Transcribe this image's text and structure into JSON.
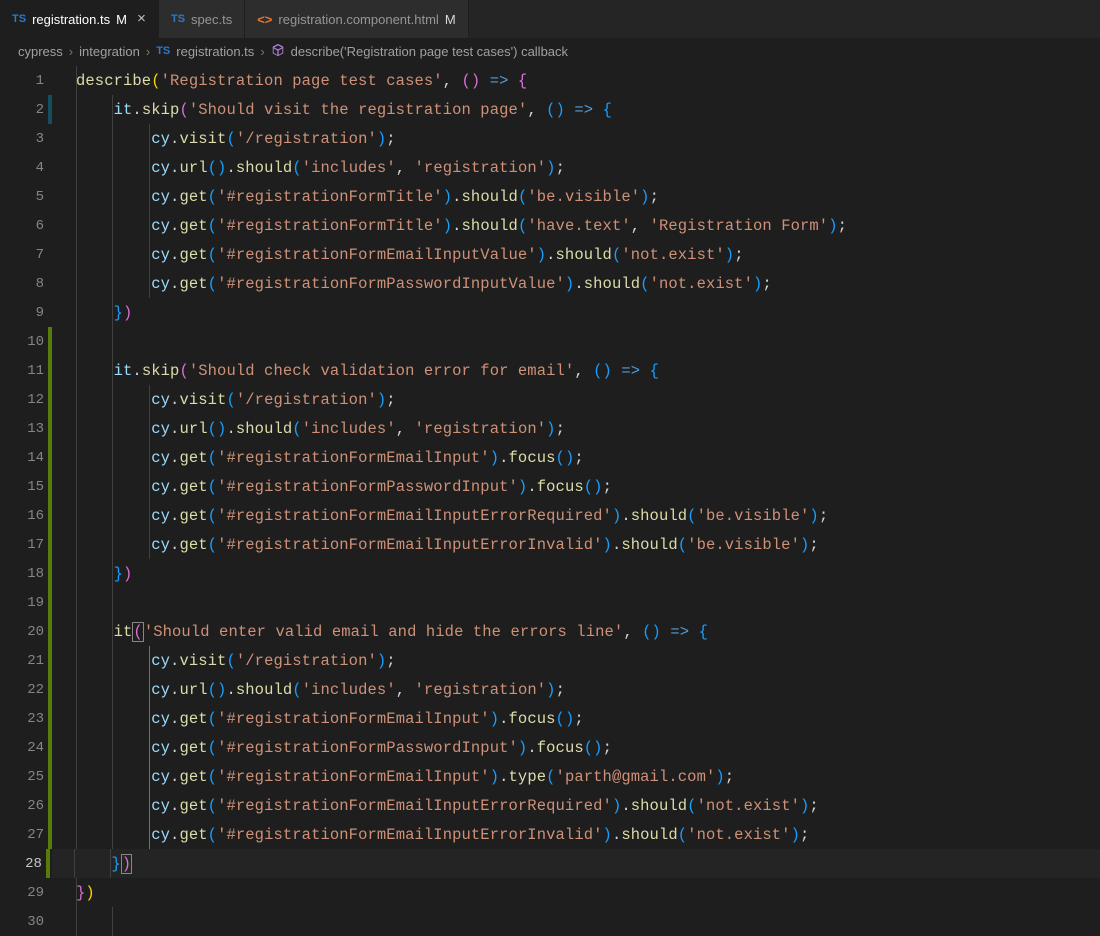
{
  "tabs": [
    {
      "icon": "TS",
      "name": "registration.ts",
      "modified": "M",
      "active": true,
      "close": true
    },
    {
      "icon": "TS",
      "name": "spec.ts",
      "modified": "",
      "active": false,
      "close": false
    },
    {
      "icon": "<>",
      "name": "registration.component.html",
      "modified": "M",
      "active": false,
      "close": false
    }
  ],
  "breadcrumb": {
    "p1": "cypress",
    "p2": "integration",
    "file_icon": "TS",
    "file": "registration.ts",
    "sym_icon": "cube",
    "symbol": "describe('Registration page test cases') callback"
  },
  "code": {
    "l1": {
      "n": "1",
      "git": "",
      "t": [
        [
          "fn",
          "describe"
        ],
        [
          "par",
          "("
        ],
        [
          "str",
          "'Registration page test cases'"
        ],
        [
          "pun",
          ", "
        ],
        [
          "par2",
          "()"
        ],
        [
          "pun",
          " "
        ],
        [
          "kw",
          "=>"
        ],
        [
          "pun",
          " "
        ],
        [
          "par2",
          "{"
        ]
      ]
    },
    "l2": {
      "n": "2",
      "git": "mod",
      "t": [
        [
          "pun",
          "    "
        ],
        [
          "var",
          "it"
        ],
        [
          "pun",
          "."
        ],
        [
          "fn",
          "skip"
        ],
        [
          "par2",
          "("
        ],
        [
          "str",
          "'Should visit the registration page'"
        ],
        [
          "pun",
          ", "
        ],
        [
          "par3",
          "()"
        ],
        [
          "pun",
          " "
        ],
        [
          "kw",
          "=>"
        ],
        [
          "pun",
          " "
        ],
        [
          "par3",
          "{"
        ]
      ]
    },
    "l3": {
      "n": "3",
      "git": "",
      "t": [
        [
          "pun",
          "        "
        ],
        [
          "var",
          "cy"
        ],
        [
          "pun",
          "."
        ],
        [
          "fn",
          "visit"
        ],
        [
          "par3",
          "("
        ],
        [
          "str",
          "'/registration'"
        ],
        [
          "par3",
          ")"
        ],
        [
          "pun",
          ";"
        ]
      ]
    },
    "l4": {
      "n": "4",
      "git": "",
      "t": [
        [
          "pun",
          "        "
        ],
        [
          "var",
          "cy"
        ],
        [
          "pun",
          "."
        ],
        [
          "fn",
          "url"
        ],
        [
          "par3",
          "()"
        ],
        [
          "pun",
          "."
        ],
        [
          "fn",
          "should"
        ],
        [
          "par3",
          "("
        ],
        [
          "str",
          "'includes'"
        ],
        [
          "pun",
          ", "
        ],
        [
          "str",
          "'registration'"
        ],
        [
          "par3",
          ")"
        ],
        [
          "pun",
          ";"
        ]
      ]
    },
    "l5": {
      "n": "5",
      "git": "",
      "t": [
        [
          "pun",
          "        "
        ],
        [
          "var",
          "cy"
        ],
        [
          "pun",
          "."
        ],
        [
          "fn",
          "get"
        ],
        [
          "par3",
          "("
        ],
        [
          "str",
          "'#registrationFormTitle'"
        ],
        [
          "par3",
          ")"
        ],
        [
          "pun",
          "."
        ],
        [
          "fn",
          "should"
        ],
        [
          "par3",
          "("
        ],
        [
          "str",
          "'be.visible'"
        ],
        [
          "par3",
          ")"
        ],
        [
          "pun",
          ";"
        ]
      ]
    },
    "l6": {
      "n": "6",
      "git": "",
      "t": [
        [
          "pun",
          "        "
        ],
        [
          "var",
          "cy"
        ],
        [
          "pun",
          "."
        ],
        [
          "fn",
          "get"
        ],
        [
          "par3",
          "("
        ],
        [
          "str",
          "'#registrationFormTitle'"
        ],
        [
          "par3",
          ")"
        ],
        [
          "pun",
          "."
        ],
        [
          "fn",
          "should"
        ],
        [
          "par3",
          "("
        ],
        [
          "str",
          "'have.text'"
        ],
        [
          "pun",
          ", "
        ],
        [
          "str",
          "'Registration Form'"
        ],
        [
          "par3",
          ")"
        ],
        [
          "pun",
          ";"
        ]
      ]
    },
    "l7": {
      "n": "7",
      "git": "",
      "t": [
        [
          "pun",
          "        "
        ],
        [
          "var",
          "cy"
        ],
        [
          "pun",
          "."
        ],
        [
          "fn",
          "get"
        ],
        [
          "par3",
          "("
        ],
        [
          "str",
          "'#registrationFormEmailInputValue'"
        ],
        [
          "par3",
          ")"
        ],
        [
          "pun",
          "."
        ],
        [
          "fn",
          "should"
        ],
        [
          "par3",
          "("
        ],
        [
          "str",
          "'not.exist'"
        ],
        [
          "par3",
          ")"
        ],
        [
          "pun",
          ";"
        ]
      ]
    },
    "l8": {
      "n": "8",
      "git": "",
      "t": [
        [
          "pun",
          "        "
        ],
        [
          "var",
          "cy"
        ],
        [
          "pun",
          "."
        ],
        [
          "fn",
          "get"
        ],
        [
          "par3",
          "("
        ],
        [
          "str",
          "'#registrationFormPasswordInputValue'"
        ],
        [
          "par3",
          ")"
        ],
        [
          "pun",
          "."
        ],
        [
          "fn",
          "should"
        ],
        [
          "par3",
          "("
        ],
        [
          "str",
          "'not.exist'"
        ],
        [
          "par3",
          ")"
        ],
        [
          "pun",
          ";"
        ]
      ]
    },
    "l9": {
      "n": "9",
      "git": "",
      "t": [
        [
          "pun",
          "    "
        ],
        [
          "par3",
          "}"
        ],
        [
          "par2",
          ")"
        ]
      ]
    },
    "l10": {
      "n": "10",
      "git": "add",
      "t": []
    },
    "l11": {
      "n": "11",
      "git": "add",
      "t": [
        [
          "pun",
          "    "
        ],
        [
          "var",
          "it"
        ],
        [
          "pun",
          "."
        ],
        [
          "fn",
          "skip"
        ],
        [
          "par2",
          "("
        ],
        [
          "str",
          "'Should check validation error for email'"
        ],
        [
          "pun",
          ", "
        ],
        [
          "par3",
          "()"
        ],
        [
          "pun",
          " "
        ],
        [
          "kw",
          "=>"
        ],
        [
          "pun",
          " "
        ],
        [
          "par3",
          "{"
        ]
      ]
    },
    "l12": {
      "n": "12",
      "git": "add",
      "t": [
        [
          "pun",
          "        "
        ],
        [
          "var",
          "cy"
        ],
        [
          "pun",
          "."
        ],
        [
          "fn",
          "visit"
        ],
        [
          "par3",
          "("
        ],
        [
          "str",
          "'/registration'"
        ],
        [
          "par3",
          ")"
        ],
        [
          "pun",
          ";"
        ]
      ]
    },
    "l13": {
      "n": "13",
      "git": "add",
      "t": [
        [
          "pun",
          "        "
        ],
        [
          "var",
          "cy"
        ],
        [
          "pun",
          "."
        ],
        [
          "fn",
          "url"
        ],
        [
          "par3",
          "()"
        ],
        [
          "pun",
          "."
        ],
        [
          "fn",
          "should"
        ],
        [
          "par3",
          "("
        ],
        [
          "str",
          "'includes'"
        ],
        [
          "pun",
          ", "
        ],
        [
          "str",
          "'registration'"
        ],
        [
          "par3",
          ")"
        ],
        [
          "pun",
          ";"
        ]
      ]
    },
    "l14": {
      "n": "14",
      "git": "add",
      "t": [
        [
          "pun",
          "        "
        ],
        [
          "var",
          "cy"
        ],
        [
          "pun",
          "."
        ],
        [
          "fn",
          "get"
        ],
        [
          "par3",
          "("
        ],
        [
          "str",
          "'#registrationFormEmailInput'"
        ],
        [
          "par3",
          ")"
        ],
        [
          "pun",
          "."
        ],
        [
          "fn",
          "focus"
        ],
        [
          "par3",
          "()"
        ],
        [
          "pun",
          ";"
        ]
      ]
    },
    "l15": {
      "n": "15",
      "git": "add",
      "t": [
        [
          "pun",
          "        "
        ],
        [
          "var",
          "cy"
        ],
        [
          "pun",
          "."
        ],
        [
          "fn",
          "get"
        ],
        [
          "par3",
          "("
        ],
        [
          "str",
          "'#registrationFormPasswordInput'"
        ],
        [
          "par3",
          ")"
        ],
        [
          "pun",
          "."
        ],
        [
          "fn",
          "focus"
        ],
        [
          "par3",
          "()"
        ],
        [
          "pun",
          ";"
        ]
      ]
    },
    "l16": {
      "n": "16",
      "git": "add",
      "t": [
        [
          "pun",
          "        "
        ],
        [
          "var",
          "cy"
        ],
        [
          "pun",
          "."
        ],
        [
          "fn",
          "get"
        ],
        [
          "par3",
          "("
        ],
        [
          "str",
          "'#registrationFormEmailInputErrorRequired'"
        ],
        [
          "par3",
          ")"
        ],
        [
          "pun",
          "."
        ],
        [
          "fn",
          "should"
        ],
        [
          "par3",
          "("
        ],
        [
          "str",
          "'be.visible'"
        ],
        [
          "par3",
          ")"
        ],
        [
          "pun",
          ";"
        ]
      ]
    },
    "l17": {
      "n": "17",
      "git": "add",
      "t": [
        [
          "pun",
          "        "
        ],
        [
          "var",
          "cy"
        ],
        [
          "pun",
          "."
        ],
        [
          "fn",
          "get"
        ],
        [
          "par3",
          "("
        ],
        [
          "str",
          "'#registrationFormEmailInputErrorInvalid'"
        ],
        [
          "par3",
          ")"
        ],
        [
          "pun",
          "."
        ],
        [
          "fn",
          "should"
        ],
        [
          "par3",
          "("
        ],
        [
          "str",
          "'be.visible'"
        ],
        [
          "par3",
          ")"
        ],
        [
          "pun",
          ";"
        ]
      ]
    },
    "l18": {
      "n": "18",
      "git": "add",
      "t": [
        [
          "pun",
          "    "
        ],
        [
          "par3",
          "}"
        ],
        [
          "par2",
          ")"
        ]
      ]
    },
    "l19": {
      "n": "19",
      "git": "add",
      "t": []
    },
    "l20": {
      "n": "20",
      "git": "add",
      "t": [
        [
          "pun",
          "    "
        ],
        [
          "fn",
          "it"
        ],
        [
          "par2",
          "("
        ],
        [
          "str",
          "'Should enter valid email and hide the errors line'"
        ],
        [
          "pun",
          ", "
        ],
        [
          "par3",
          "()"
        ],
        [
          "pun",
          " "
        ],
        [
          "kw",
          "=>"
        ],
        [
          "pun",
          " "
        ],
        [
          "par3",
          "{"
        ]
      ]
    },
    "l21": {
      "n": "21",
      "git": "add",
      "t": [
        [
          "pun",
          "        "
        ],
        [
          "var",
          "cy"
        ],
        [
          "pun",
          "."
        ],
        [
          "fn",
          "visit"
        ],
        [
          "par3",
          "("
        ],
        [
          "str",
          "'/registration'"
        ],
        [
          "par3",
          ")"
        ],
        [
          "pun",
          ";"
        ]
      ]
    },
    "l22": {
      "n": "22",
      "git": "add",
      "t": [
        [
          "pun",
          "        "
        ],
        [
          "var",
          "cy"
        ],
        [
          "pun",
          "."
        ],
        [
          "fn",
          "url"
        ],
        [
          "par3",
          "()"
        ],
        [
          "pun",
          "."
        ],
        [
          "fn",
          "should"
        ],
        [
          "par3",
          "("
        ],
        [
          "str",
          "'includes'"
        ],
        [
          "pun",
          ", "
        ],
        [
          "str",
          "'registration'"
        ],
        [
          "par3",
          ")"
        ],
        [
          "pun",
          ";"
        ]
      ]
    },
    "l23": {
      "n": "23",
      "git": "add",
      "t": [
        [
          "pun",
          "        "
        ],
        [
          "var",
          "cy"
        ],
        [
          "pun",
          "."
        ],
        [
          "fn",
          "get"
        ],
        [
          "par3",
          "("
        ],
        [
          "str",
          "'#registrationFormEmailInput'"
        ],
        [
          "par3",
          ")"
        ],
        [
          "pun",
          "."
        ],
        [
          "fn",
          "focus"
        ],
        [
          "par3",
          "()"
        ],
        [
          "pun",
          ";"
        ]
      ]
    },
    "l24": {
      "n": "24",
      "git": "add",
      "t": [
        [
          "pun",
          "        "
        ],
        [
          "var",
          "cy"
        ],
        [
          "pun",
          "."
        ],
        [
          "fn",
          "get"
        ],
        [
          "par3",
          "("
        ],
        [
          "str",
          "'#registrationFormPasswordInput'"
        ],
        [
          "par3",
          ")"
        ],
        [
          "pun",
          "."
        ],
        [
          "fn",
          "focus"
        ],
        [
          "par3",
          "()"
        ],
        [
          "pun",
          ";"
        ]
      ]
    },
    "l25": {
      "n": "25",
      "git": "add",
      "t": [
        [
          "pun",
          "        "
        ],
        [
          "var",
          "cy"
        ],
        [
          "pun",
          "."
        ],
        [
          "fn",
          "get"
        ],
        [
          "par3",
          "("
        ],
        [
          "str",
          "'#registrationFormEmailInput'"
        ],
        [
          "par3",
          ")"
        ],
        [
          "pun",
          "."
        ],
        [
          "fn",
          "type"
        ],
        [
          "par3",
          "("
        ],
        [
          "str",
          "'parth@gmail.com'"
        ],
        [
          "par3",
          ")"
        ],
        [
          "pun",
          ";"
        ]
      ]
    },
    "l26": {
      "n": "26",
      "git": "add",
      "t": [
        [
          "pun",
          "        "
        ],
        [
          "var",
          "cy"
        ],
        [
          "pun",
          "."
        ],
        [
          "fn",
          "get"
        ],
        [
          "par3",
          "("
        ],
        [
          "str",
          "'#registrationFormEmailInputErrorRequired'"
        ],
        [
          "par3",
          ")"
        ],
        [
          "pun",
          "."
        ],
        [
          "fn",
          "should"
        ],
        [
          "par3",
          "("
        ],
        [
          "str",
          "'not.exist'"
        ],
        [
          "par3",
          ")"
        ],
        [
          "pun",
          ";"
        ]
      ]
    },
    "l27": {
      "n": "27",
      "git": "add",
      "t": [
        [
          "pun",
          "        "
        ],
        [
          "var",
          "cy"
        ],
        [
          "pun",
          "."
        ],
        [
          "fn",
          "get"
        ],
        [
          "par3",
          "("
        ],
        [
          "str",
          "'#registrationFormEmailInputErrorInvalid'"
        ],
        [
          "par3",
          ")"
        ],
        [
          "pun",
          "."
        ],
        [
          "fn",
          "should"
        ],
        [
          "par3",
          "("
        ],
        [
          "str",
          "'not.exist'"
        ],
        [
          "par3",
          ")"
        ],
        [
          "pun",
          ";"
        ]
      ]
    },
    "l28": {
      "n": "28",
      "git": "add",
      "t": [
        [
          "pun",
          "    "
        ],
        [
          "par3",
          "}"
        ],
        [
          "par2",
          ")"
        ]
      ],
      "current": true
    },
    "l29": {
      "n": "29",
      "git": "",
      "t": [
        [
          "par2",
          "}"
        ],
        [
          "par",
          ")"
        ]
      ]
    },
    "l30": {
      "n": "30",
      "git": "",
      "t": []
    }
  }
}
